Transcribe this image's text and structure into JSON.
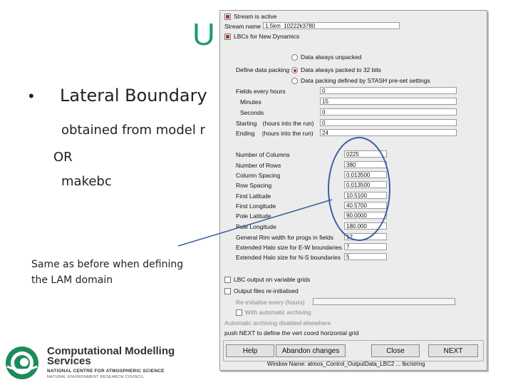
{
  "slide": {
    "title": "U",
    "bullet": "•",
    "bullet_text": "Lateral Boundary",
    "line1": "obtained from model r",
    "line2": "OR",
    "line3": "makebc",
    "note": "Same as before when defining the LAM domain"
  },
  "logo": {
    "org_name": "Computational Modelling Services",
    "sub1": "NATIONAL CENTRE FOR ATMOSPHERIC SCIENCE",
    "sub2": "NATURAL ENVIRONMENT RESEARCH COUNCIL"
  },
  "dialog": {
    "stream_active_label": "Stream is active",
    "stream_name_label": "Stream name",
    "stream_name_value": "1.5km_10222k3780",
    "lbc_new_dynamics_label": "LBCs for New Dynamics",
    "data_packing_label": "Define data packing",
    "packing_options": [
      {
        "label": "Data always unpacked",
        "selected": false
      },
      {
        "label": "Data always packed to 32 bits",
        "selected": true
      },
      {
        "label": "Data packing defined by STASH pre-set settings",
        "selected": false
      }
    ],
    "fields_every_hours_label": "Fields every hours",
    "fields_every_hours_value": "0",
    "minutes_label": "Minutes",
    "minutes_value": "15",
    "seconds_label": "Seconds",
    "seconds_value": "0",
    "starting_label": "Starting",
    "starting_hint": "(hours into the run)",
    "starting_value": "0",
    "ending_label": "Ending",
    "ending_hint": "(hours into the run)",
    "ending_value": "24",
    "grid_rows": [
      {
        "label": "Number of Columns",
        "value": "0225"
      },
      {
        "label": "Number of Rows",
        "value": "380"
      },
      {
        "label": "Column Spacing",
        "value": "0.013500"
      },
      {
        "label": "Row Spacing",
        "value": "0.013500"
      },
      {
        "label": "First Latitude",
        "value": "10.5100"
      },
      {
        "label": "First Longitude",
        "value": "40.5700"
      },
      {
        "label": "Pole Latitude",
        "value": "90.0000"
      },
      {
        "label": "Pole Longitude",
        "value": "180.000"
      },
      {
        "label": "General Rim width for progs in fields",
        "value": "12"
      },
      {
        "label": "Extended Halo size for E-W boundaries",
        "value": "7"
      },
      {
        "label": "Extended Halo size for N-S boundaries",
        "value": "5"
      }
    ],
    "lbc_variable_grids_label": "LBC output on variable grids",
    "output_reinit_label": "Output files re-initialised",
    "reinit_every_label": "Re-initialise every (hours)",
    "auto_archiving_label": "With automatic archiving",
    "archiving_note": "Automatic archiving disabled elsewhere",
    "push_next_note": "push NEXT to define the vert coord horizontal grid",
    "buttons": {
      "help": "Help",
      "abandon": "Abandon changes",
      "close": "Close",
      "next": "NEXT"
    },
    "window_name": "Window Name: atmos_Control_OutputData_LBC2 ... lbc/string"
  },
  "colors": {
    "title_green": "#1d9b74",
    "highlight_blue": "#3a5fa0",
    "check_red": "#b03030"
  }
}
